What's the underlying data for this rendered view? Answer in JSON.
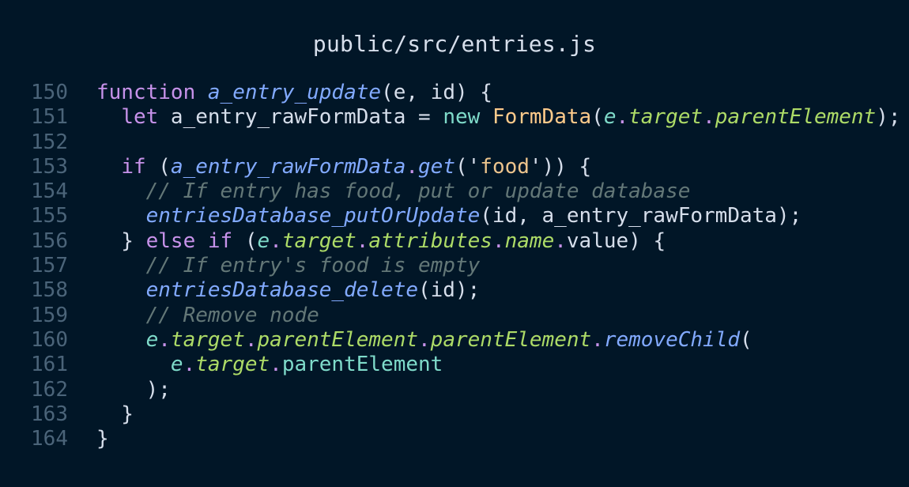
{
  "editor": {
    "file_title": "public/src/entries.js",
    "colors": {
      "background": "#011627",
      "default": "#d6deeb",
      "keyword": "#c792ea",
      "function": "#82aaff",
      "class": "#ffcb8b",
      "string": "#ecc48d",
      "comment": "#637777",
      "property": "#addb67",
      "variable": "#7fdbca",
      "line_number": "#4b6479"
    },
    "lines": [
      {
        "num": "150",
        "tokens": [
          {
            "t": "function",
            "k": "keyword"
          },
          {
            "t": " "
          },
          {
            "t": "a_entry_update",
            "k": "function",
            "i": true
          },
          {
            "t": "(e, id) {"
          }
        ]
      },
      {
        "num": "151",
        "tokens": [
          {
            "t": "  "
          },
          {
            "t": "let",
            "k": "keyword"
          },
          {
            "t": " a_entry_rawFormData = "
          },
          {
            "t": "new",
            "k": "variable"
          },
          {
            "t": " "
          },
          {
            "t": "FormData",
            "k": "class"
          },
          {
            "t": "("
          },
          {
            "t": "e",
            "k": "variable",
            "i": true
          },
          {
            "t": ".",
            "k": "keyword"
          },
          {
            "t": "target",
            "k": "property",
            "i": true
          },
          {
            "t": ".",
            "k": "keyword"
          },
          {
            "t": "parentElement",
            "k": "property",
            "i": true
          },
          {
            "t": ");"
          }
        ]
      },
      {
        "num": "152",
        "tokens": []
      },
      {
        "num": "153",
        "tokens": [
          {
            "t": "  "
          },
          {
            "t": "if",
            "k": "keyword"
          },
          {
            "t": " ("
          },
          {
            "t": "a_entry_rawFormData",
            "k": "function",
            "i": true
          },
          {
            "t": ".",
            "k": "keyword"
          },
          {
            "t": "get",
            "k": "function",
            "i": true
          },
          {
            "t": "('"
          },
          {
            "t": "food",
            "k": "string"
          },
          {
            "t": "')) {"
          }
        ]
      },
      {
        "num": "154",
        "tokens": [
          {
            "t": "    "
          },
          {
            "t": "// If entry has food, put or update database",
            "k": "comment",
            "i": true
          }
        ]
      },
      {
        "num": "155",
        "tokens": [
          {
            "t": "    "
          },
          {
            "t": "entriesDatabase_putOrUpdate",
            "k": "function",
            "i": true
          },
          {
            "t": "(id, a_entry_rawFormData);"
          }
        ]
      },
      {
        "num": "156",
        "tokens": [
          {
            "t": "  } "
          },
          {
            "t": "else",
            "k": "keyword"
          },
          {
            "t": " "
          },
          {
            "t": "if",
            "k": "keyword"
          },
          {
            "t": " ("
          },
          {
            "t": "e",
            "k": "variable",
            "i": true
          },
          {
            "t": ".",
            "k": "keyword"
          },
          {
            "t": "target",
            "k": "property",
            "i": true
          },
          {
            "t": ".",
            "k": "keyword"
          },
          {
            "t": "attributes",
            "k": "property",
            "i": true
          },
          {
            "t": ".",
            "k": "keyword"
          },
          {
            "t": "name",
            "k": "property",
            "i": true
          },
          {
            "t": ".",
            "k": "keyword"
          },
          {
            "t": "value"
          },
          {
            "t": ") {"
          }
        ]
      },
      {
        "num": "157",
        "tokens": [
          {
            "t": "    "
          },
          {
            "t": "// If entry's food is empty",
            "k": "comment",
            "i": true
          }
        ]
      },
      {
        "num": "158",
        "tokens": [
          {
            "t": "    "
          },
          {
            "t": "entriesDatabase_delete",
            "k": "function",
            "i": true
          },
          {
            "t": "(id);"
          }
        ]
      },
      {
        "num": "159",
        "tokens": [
          {
            "t": "    "
          },
          {
            "t": "// Remove node",
            "k": "comment",
            "i": true
          }
        ]
      },
      {
        "num": "160",
        "tokens": [
          {
            "t": "    "
          },
          {
            "t": "e",
            "k": "variable",
            "i": true
          },
          {
            "t": ".",
            "k": "keyword"
          },
          {
            "t": "target",
            "k": "property",
            "i": true
          },
          {
            "t": ".",
            "k": "keyword"
          },
          {
            "t": "parentElement",
            "k": "property",
            "i": true
          },
          {
            "t": ".",
            "k": "keyword"
          },
          {
            "t": "parentElement",
            "k": "property",
            "i": true
          },
          {
            "t": ".",
            "k": "keyword"
          },
          {
            "t": "removeChild",
            "k": "function",
            "i": true
          },
          {
            "t": "("
          }
        ]
      },
      {
        "num": "161",
        "tokens": [
          {
            "t": "      "
          },
          {
            "t": "e",
            "k": "variable",
            "i": true
          },
          {
            "t": ".",
            "k": "keyword"
          },
          {
            "t": "target",
            "k": "property",
            "i": true
          },
          {
            "t": ".",
            "k": "keyword"
          },
          {
            "t": "parentElement",
            "k": "variable"
          }
        ]
      },
      {
        "num": "162",
        "tokens": [
          {
            "t": "    );"
          }
        ]
      },
      {
        "num": "163",
        "tokens": [
          {
            "t": "  }"
          }
        ]
      },
      {
        "num": "164",
        "tokens": [
          {
            "t": "}"
          }
        ]
      }
    ]
  }
}
